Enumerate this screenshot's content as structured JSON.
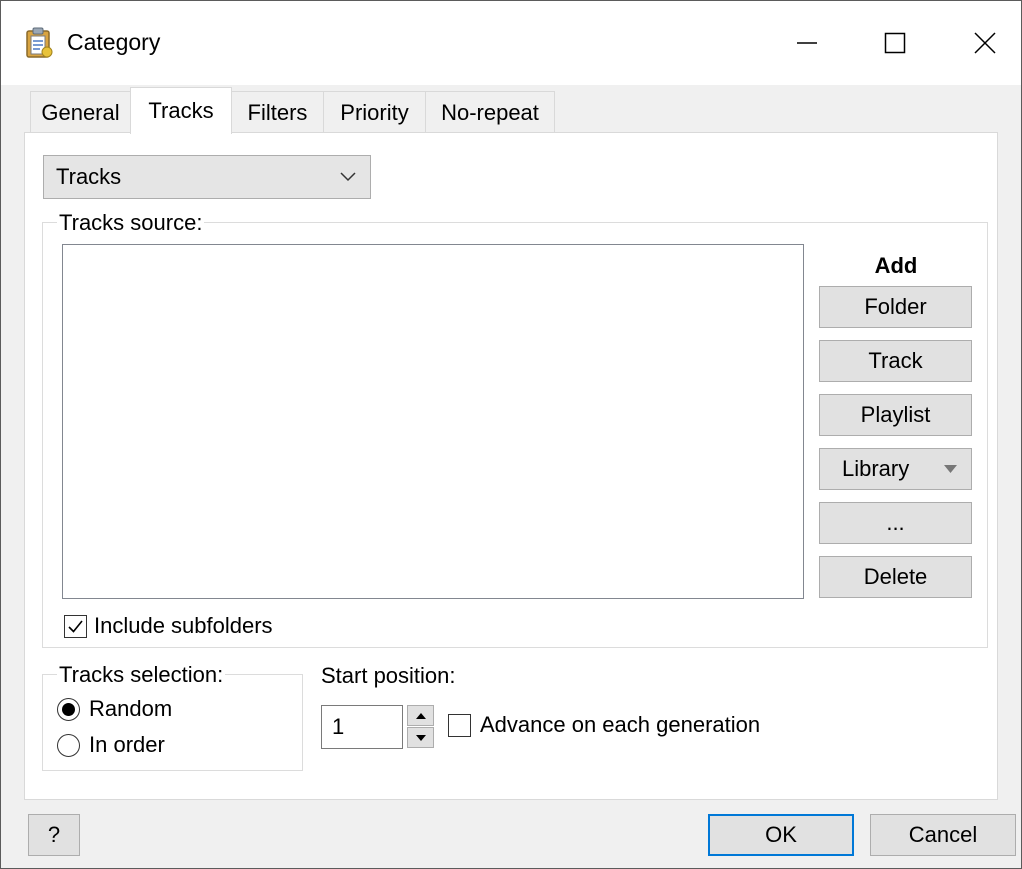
{
  "window": {
    "title": "Category",
    "app_icon": "clipboard-icon",
    "controls": [
      "minimize-icon",
      "maximize-icon",
      "close-icon"
    ]
  },
  "tabs": [
    {
      "label": "General",
      "active": false
    },
    {
      "label": "Tracks",
      "active": true
    },
    {
      "label": "Filters",
      "active": false
    },
    {
      "label": "Priority",
      "active": false
    },
    {
      "label": "No-repeat",
      "active": false
    }
  ],
  "source_type": {
    "selected": "Tracks"
  },
  "tracks_source": {
    "legend": "Tracks source:",
    "items": [],
    "add_label": "Add",
    "buttons": {
      "folder": "Folder",
      "track": "Track",
      "playlist": "Playlist",
      "library": "Library",
      "more": "...",
      "delete": "Delete"
    },
    "include_subfolders": {
      "label": "Include subfolders",
      "checked": true
    }
  },
  "tracks_selection": {
    "legend": "Tracks selection:",
    "options": [
      {
        "label": "Random",
        "selected": true
      },
      {
        "label": "In order",
        "selected": false
      }
    ]
  },
  "start_position": {
    "label": "Start position:",
    "value": "1",
    "advance": {
      "label": "Advance on each generation",
      "checked": false
    }
  },
  "footer": {
    "help_label": "?",
    "ok_label": "OK",
    "cancel_label": "Cancel"
  },
  "colors": {
    "focus_border": "#0078d7",
    "button_face": "#e1e1e1",
    "panel_bg": "#ffffff",
    "dialog_bg": "#f0f0f0"
  }
}
